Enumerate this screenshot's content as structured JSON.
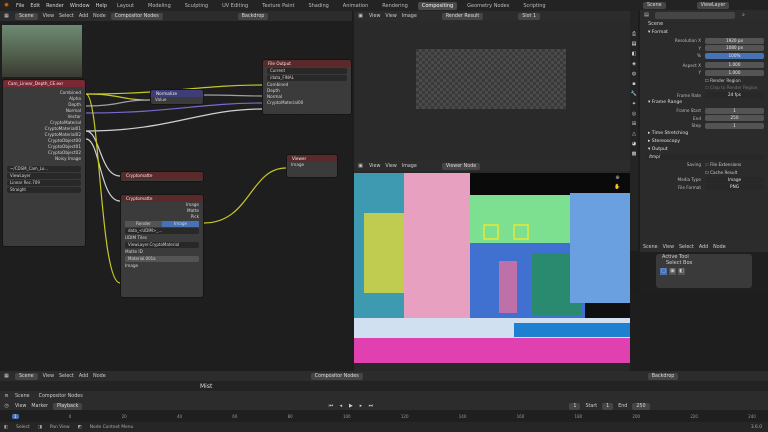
{
  "topbar": {
    "menus": [
      "File",
      "Edit",
      "Render",
      "Window",
      "Help"
    ],
    "workspaces": [
      "Layout",
      "Modeling",
      "Sculpting",
      "UV Editing",
      "Texture Paint",
      "Shading",
      "Animation",
      "Rendering",
      "Compositing",
      "Geometry Nodes",
      "Scripting"
    ],
    "active_workspace": "Compositing",
    "scene": "Scene",
    "view_layer": "ViewLayer"
  },
  "node_header": {
    "editor": "Compositor Nodes",
    "menus": [
      "View",
      "Select",
      "Add",
      "Node"
    ],
    "backdrop": "Backdrop"
  },
  "nodes": {
    "render_layers": {
      "title": "Cam_Linear_Depth_CE.exr",
      "outputs": [
        "Combined",
        "Alpha",
        "Depth",
        "Normal",
        "Vector",
        "CryptoMaterial",
        "CryptoMaterial01",
        "CryptoMaterial02",
        "CryptoObject00",
        "CryptoObject01",
        "CryptoObject02",
        "Noisy Image"
      ],
      "file": "~/CDSM_Cam_Lo...",
      "view_layer": "ViewLayer",
      "colorspace": "Linear Rec.709",
      "view": "Straight"
    },
    "normalize": {
      "title": "Normalize",
      "input": "Value"
    },
    "file_output": {
      "title": "File Output",
      "format": "Current",
      "path": "/data_FINAL",
      "inputs": [
        "Combined",
        "Depth",
        "Normal",
        "CryptoMaterial00"
      ]
    },
    "cryptomatte_small": {
      "title": "Cryptomatte"
    },
    "cryptomatte": {
      "title": "Cryptomatte",
      "outputs": [
        "Image",
        "Matte",
        "Pick"
      ],
      "tabs": [
        "Render",
        "Image"
      ],
      "image": "data_<UDIM>_...",
      "udim": "UDIM Tiles",
      "layer": "ViewLayer.CryptoMaterial",
      "matte_id_label": "Matte ID",
      "matte_id": "Material.001a",
      "input": "Image"
    },
    "viewer": {
      "title": "Viewer",
      "input": "Image"
    }
  },
  "image_header": {
    "menus": [
      "View",
      "View",
      "Image"
    ],
    "image": "Render Result",
    "slot": "Slot 1"
  },
  "viewer_header": {
    "menus": [
      "View",
      "View",
      "Image"
    ],
    "image": "Viewer Node"
  },
  "properties": {
    "search": "",
    "scene": "Scene",
    "sections": {
      "format": "Format",
      "frame_range": "Frame Range",
      "time_stretching": "Time Stretching",
      "stereoscopy": "Stereoscopy",
      "output": "Output"
    },
    "format_rows": [
      {
        "label": "Resolution X",
        "value": "1920 px"
      },
      {
        "label": "Y",
        "value": "1080 px"
      },
      {
        "label": "%",
        "value": "100%"
      },
      {
        "label": "Aspect X",
        "value": "1.000"
      },
      {
        "label": "Y",
        "value": "1.000"
      }
    ],
    "render_region": "Render Region",
    "crop_region": "Crop to Render Region",
    "frame_rate_label": "Frame Rate",
    "frame_rate": "24 fps",
    "frame_rows": [
      {
        "label": "Frame Start",
        "value": "1"
      },
      {
        "label": "End",
        "value": "250"
      },
      {
        "label": "Step",
        "value": "1"
      }
    ],
    "output_path": "/tmp/",
    "saving_label": "Saving",
    "file_extensions": "File Extensions",
    "cache_result": "Cache Result",
    "media_type_label": "Media Type",
    "media_type": "Image",
    "file_format_label": "File Format",
    "file_format": "PNG",
    "color": "Color"
  },
  "active_tool": {
    "menus": [
      "Scene",
      "View",
      "Select",
      "Add",
      "Node"
    ],
    "title": "Active Tool",
    "tool": "Select Box"
  },
  "bottom": {
    "editor": "Compositor Nodes",
    "menus": [
      "View",
      "Select",
      "Add",
      "Node"
    ],
    "backdrop": "Backdrop",
    "label": "Mist",
    "scene": "Scene",
    "timeline_menus": [
      "View",
      "Marker",
      "Playback"
    ],
    "frame": "1",
    "start_label": "Start",
    "start": "1",
    "end_label": "End",
    "end": "250",
    "ruler": [
      "0",
      "20",
      "40",
      "60",
      "80",
      "100",
      "120",
      "140",
      "160",
      "180",
      "200",
      "220",
      "240"
    ]
  },
  "status": {
    "items": [
      "Select",
      "Pan View",
      "Node Context Menu"
    ],
    "version": "3.6.0"
  }
}
